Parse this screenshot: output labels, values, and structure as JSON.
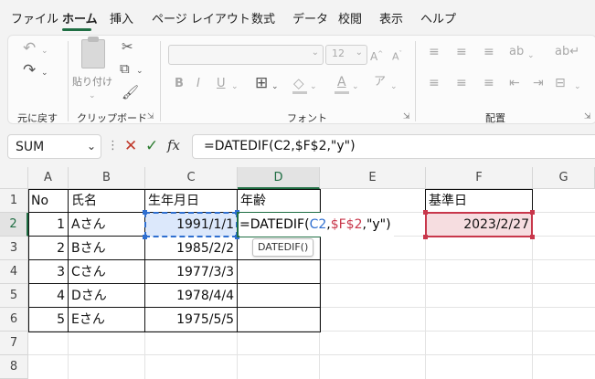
{
  "menu": {
    "tabs": [
      "ファイル",
      "ホーム",
      "挿入",
      "ページ レイアウト",
      "数式",
      "データ",
      "校閲",
      "表示",
      "ヘルプ"
    ],
    "active": "ホーム"
  },
  "ribbon": {
    "groups": {
      "undo": "元に戻す",
      "clipboard": "クリップボード",
      "font": "フォント",
      "alignment": "配置"
    },
    "paste_label": "貼り付け",
    "font_size": "12"
  },
  "formula_bar": {
    "name_box": "SUM",
    "fx_label": "fx",
    "formula": "=DATEDIF(C2,$F$2,\"y\")"
  },
  "sheet": {
    "columns": [
      "A",
      "B",
      "C",
      "D",
      "E",
      "F",
      "G"
    ],
    "rows": [
      "1",
      "2",
      "3",
      "4",
      "5",
      "6",
      "7",
      "8"
    ],
    "headers": {
      "no": "No",
      "name": "氏名",
      "birth": "生年月日",
      "age": "年齢",
      "base": "基準日"
    },
    "data": [
      {
        "no": "1",
        "name": "Aさん",
        "birth": "1991/1/1"
      },
      {
        "no": "2",
        "name": "Bさん",
        "birth": "1985/2/2"
      },
      {
        "no": "3",
        "name": "Cさん",
        "birth": "1977/3/3"
      },
      {
        "no": "4",
        "name": "Dさん",
        "birth": "1978/4/4"
      },
      {
        "no": "5",
        "name": "Eさん",
        "birth": "1975/5/5"
      }
    ],
    "base_date": "2023/2/27",
    "editing": {
      "prefix": "=DATEDIF(",
      "arg1": "C2",
      "comma1": ",",
      "arg2": "$F$2",
      "rest": ",\"y\")"
    },
    "tooltip": "DATEDIF()"
  },
  "colors": {
    "accent": "#1f6e43",
    "ref_blue": "#2f6fd0",
    "ref_red": "#c8374b"
  }
}
